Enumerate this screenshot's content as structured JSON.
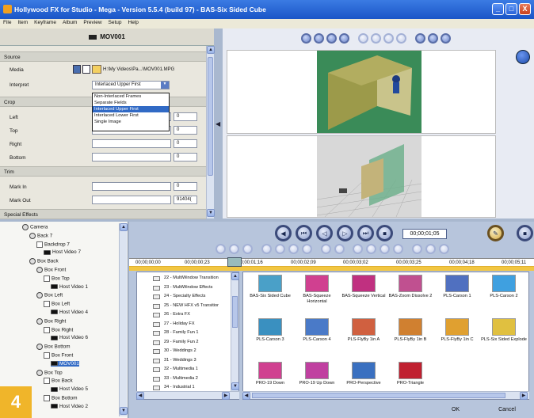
{
  "window": {
    "title": "Hollywood FX for Studio - Mega - Version 5.5.4 (build 97) - BAS-Six Sided Cube",
    "controls": [
      "_",
      "□",
      "X"
    ]
  },
  "menu": [
    "File",
    "Item",
    "Keyframe",
    "Album",
    "Preview",
    "Setup",
    "Help"
  ],
  "clip_header": "MOV001",
  "source": {
    "section_label": "Source",
    "media_label": "Media",
    "media_path": "H:\\My Videos\\Pa...\\MOV001.MPG",
    "interpret_label": "Interpret",
    "interpret_value": "Interlaced Upper First",
    "interpret_options": [
      "Non-Interlaced Frames",
      "Separate Fields",
      "Interlaced Upper First",
      "Interlaced Lower First",
      "Single Image"
    ],
    "interpret_selected_index": 2
  },
  "crop": {
    "section_label": "Crop",
    "fields": [
      {
        "label": "Left",
        "value": "0"
      },
      {
        "label": "Top",
        "value": "0"
      },
      {
        "label": "Right",
        "value": "0"
      },
      {
        "label": "Bottom",
        "value": "0"
      }
    ]
  },
  "trim": {
    "section_label": "Trim",
    "mark_in_label": "Mark In",
    "mark_in_value": "0",
    "mark_out_label": "Mark Out",
    "mark_out_value": "91404("
  },
  "special_effects_label": "Special Effects",
  "tree": [
    {
      "label": "Camera",
      "indent": 0,
      "type": "obj"
    },
    {
      "label": "Back 7",
      "indent": 1,
      "type": "obj"
    },
    {
      "label": "Backdrop 7",
      "indent": 2,
      "type": "drop"
    },
    {
      "label": "Host Video 7",
      "indent": 3,
      "type": "vid"
    },
    {
      "label": "Box Back",
      "indent": 1,
      "type": "obj"
    },
    {
      "label": "Box Front",
      "indent": 2,
      "type": "obj"
    },
    {
      "label": "Box Top",
      "indent": 3,
      "type": "drop"
    },
    {
      "label": "Host Video 1",
      "indent": 4,
      "type": "vid"
    },
    {
      "label": "Box Left",
      "indent": 2,
      "type": "obj"
    },
    {
      "label": "Box Left",
      "indent": 3,
      "type": "drop"
    },
    {
      "label": "Host Video 4",
      "indent": 4,
      "type": "vid"
    },
    {
      "label": "Box Right",
      "indent": 2,
      "type": "obj"
    },
    {
      "label": "Box Right",
      "indent": 3,
      "type": "drop"
    },
    {
      "label": "Host Video 6",
      "indent": 4,
      "type": "vid"
    },
    {
      "label": "Box Bottom",
      "indent": 2,
      "type": "obj"
    },
    {
      "label": "Box Front",
      "indent": 3,
      "type": "drop"
    },
    {
      "label": "MOV001",
      "indent": 4,
      "type": "vid",
      "highlight": true
    },
    {
      "label": "Box Top",
      "indent": 2,
      "type": "obj"
    },
    {
      "label": "Box Back",
      "indent": 3,
      "type": "drop"
    },
    {
      "label": "Host Video 5",
      "indent": 4,
      "type": "vid"
    },
    {
      "label": "Box Bottom",
      "indent": 3,
      "type": "drop"
    },
    {
      "label": "Host Video 2",
      "indent": 4,
      "type": "vid"
    }
  ],
  "timecode": "00;00;01;05",
  "timeline_ticks": [
    "00;00;00;00",
    "00;00;00;23",
    "00;00;01;16",
    "00;00;02;09",
    "00;00;03;02",
    "00;00;03;25",
    "00;00;04;18",
    "00;00;05;11"
  ],
  "categories": [
    "22 - MultiWindow Transition",
    "23 - MultiWindow Effects",
    "24 - Specialty Effects",
    "25 - NEW HFX v5 Transitior",
    "26 - Extra FX",
    "27 - Holiday FX",
    "28 - Family Fun 1",
    "29 - Family Fun 2",
    "30 - Weddings 2",
    "31 - Weddings 3",
    "32 - Multimedia 1",
    "33 - Multimedia 2",
    "34 - Industrial 1"
  ],
  "effects": [
    {
      "label": "BAS-Six Sided Cube",
      "color": "#4aa0c8"
    },
    {
      "label": "BAS-Squeeze Horizontal",
      "color": "#d04090"
    },
    {
      "label": "BAS-Squeeze Vertical",
      "color": "#c03080"
    },
    {
      "label": "BAS-Zoom Dissolve 2",
      "color": "#c05090"
    },
    {
      "label": "PLS-Carson 1",
      "color": "#5070c0"
    },
    {
      "label": "PLS-Carson 2",
      "color": "#3fa0e0"
    },
    {
      "label": "PLS-Carson 3",
      "color": "#3a90c0"
    },
    {
      "label": "PLS-Carson 4",
      "color": "#4a7ac8"
    },
    {
      "label": "PLS-FlyBy 1in A",
      "color": "#d06040"
    },
    {
      "label": "PLS-FlyBy 1in B",
      "color": "#d08030"
    },
    {
      "label": "PLS-FlyBy 1in C",
      "color": "#e0a030"
    },
    {
      "label": "PLS-Six Sided Explode",
      "color": "#e0c040"
    },
    {
      "label": "PRO-19 Down",
      "color": "#d04090"
    },
    {
      "label": "PRO-19 Up Down",
      "color": "#c040a0"
    },
    {
      "label": "PRO-Perspective",
      "color": "#3a70c0"
    },
    {
      "label": "PRO-Triangle",
      "color": "#c02030"
    }
  ],
  "buttons": {
    "ok": "OK",
    "cancel": "Cancel"
  },
  "badge": "4"
}
